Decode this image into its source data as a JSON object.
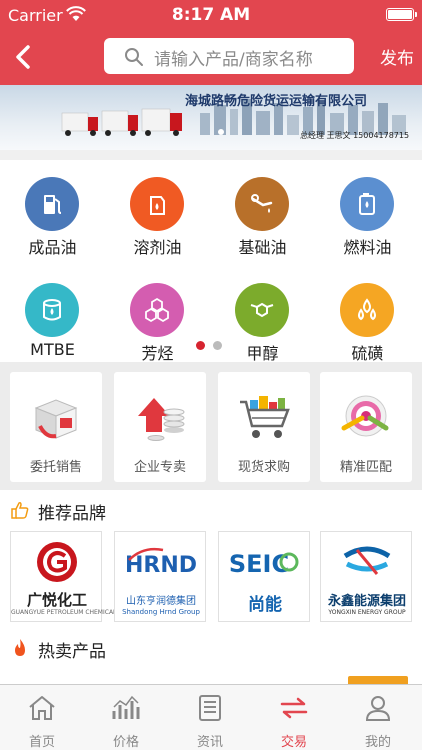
{
  "status_bar": {
    "carrier": "Carrier",
    "time": "8:17 AM"
  },
  "nav": {
    "search_placeholder": "请输入产品/商家名称",
    "publish": "发布"
  },
  "banner": {
    "company": "海城路畅危险货运运输有限公司",
    "contact": "总经理 王思文 15004178715"
  },
  "categories": [
    {
      "label": "成品油",
      "color": "#4a78b8",
      "icon": "fuel-pump-icon"
    },
    {
      "label": "溶剂油",
      "color": "#f05a23",
      "icon": "oil-can-icon"
    },
    {
      "label": "基础油",
      "color": "#b8702a",
      "icon": "oil-drop-icon"
    },
    {
      "label": "燃料油",
      "color": "#5b8fd0",
      "icon": "fuel-tank-icon"
    },
    {
      "label": "MTBE",
      "color": "#35b8c8",
      "icon": "barrel-icon"
    },
    {
      "label": "芳烃",
      "color": "#d45db0",
      "icon": "hexagon-icon"
    },
    {
      "label": "甲醇",
      "color": "#7cab2c",
      "icon": "molecule-icon"
    },
    {
      "label": "硫磺",
      "color": "#f5a623",
      "icon": "flame-drops-icon"
    }
  ],
  "services": [
    {
      "label": "委托销售",
      "icon": "box-icon"
    },
    {
      "label": "企业专卖",
      "icon": "coins-icon"
    },
    {
      "label": "现货求购",
      "icon": "cart-icon"
    },
    {
      "label": "精准匹配",
      "icon": "target-icon"
    }
  ],
  "recommended": {
    "title": "推荐品牌",
    "brands": [
      {
        "name": "广悦化工",
        "sub": "GUANGYUE PETROLEUM CHEMICAL",
        "color": "#c8161d"
      },
      {
        "name": "山东亨润德集团",
        "sub": "Shandong Hrnd Group",
        "color": "#1d5fb0"
      },
      {
        "name": "尚能",
        "sub": "",
        "color": "#1565b0"
      },
      {
        "name": "永鑫能源集团",
        "sub": "YONGXIN ENERGY GROUP",
        "color": "#0d63a8"
      }
    ]
  },
  "hot": {
    "title": "热卖产品"
  },
  "tabs": [
    {
      "label": "首页",
      "icon": "home-icon"
    },
    {
      "label": "价格",
      "icon": "chart-icon"
    },
    {
      "label": "资讯",
      "icon": "news-icon"
    },
    {
      "label": "交易",
      "icon": "exchange-icon"
    },
    {
      "label": "我的",
      "icon": "user-icon"
    }
  ]
}
